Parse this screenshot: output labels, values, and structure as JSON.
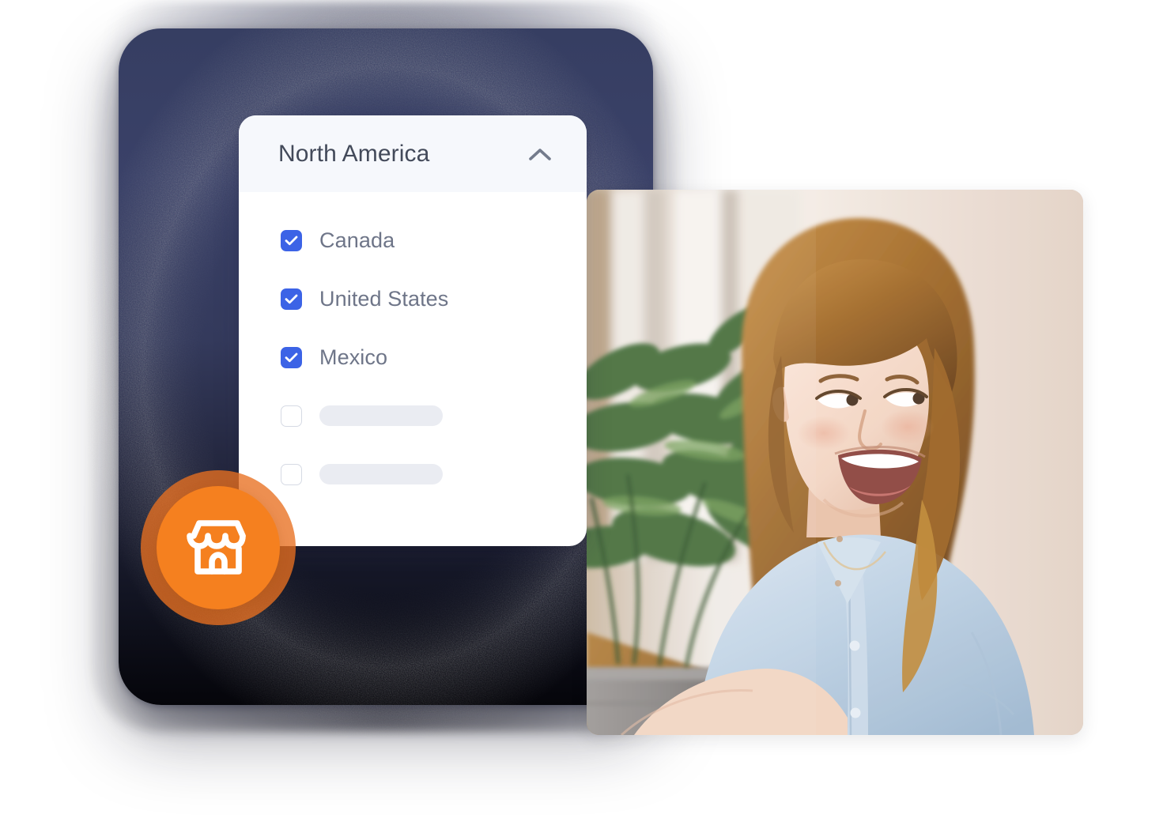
{
  "page": {
    "title": "Region selector with smiling person photo",
    "background_color": "#ffffff"
  },
  "dark_card": {
    "name": "background-card",
    "top_color": "#3a4168",
    "bottom_color": "#05050a"
  },
  "dropdown": {
    "header": {
      "title": "North America",
      "toggle_icon": "chevron-up-icon",
      "toggle_state": "expanded",
      "background_color": "#f6f8fc",
      "title_color": "#434a5a"
    },
    "accent_color": "#3c63e6",
    "items": [
      {
        "label": "Canada",
        "checked": true,
        "placeholder": false
      },
      {
        "label": "United States",
        "checked": true,
        "placeholder": false
      },
      {
        "label": "Mexico",
        "checked": true,
        "placeholder": false
      },
      {
        "label": "",
        "checked": false,
        "placeholder": true
      },
      {
        "label": "",
        "checked": false,
        "placeholder": true
      }
    ]
  },
  "badge": {
    "icon": "storefront-icon",
    "ring_color": "#e87020",
    "fill_color": "#f5801f",
    "icon_color": "#ffffff"
  },
  "photo": {
    "alt": "Smiling woman with auburn hair in a light blue denim shirt sitting at a wooden table beside a potted plant",
    "subject": "smiling-person",
    "accent_colors": {
      "wall": "#e8ddd4",
      "hair": "#a9702f",
      "shirt": "#bcd0e2",
      "plant": "#3f6b38",
      "table": "#a9752f",
      "pot": "#8d8b88"
    }
  }
}
